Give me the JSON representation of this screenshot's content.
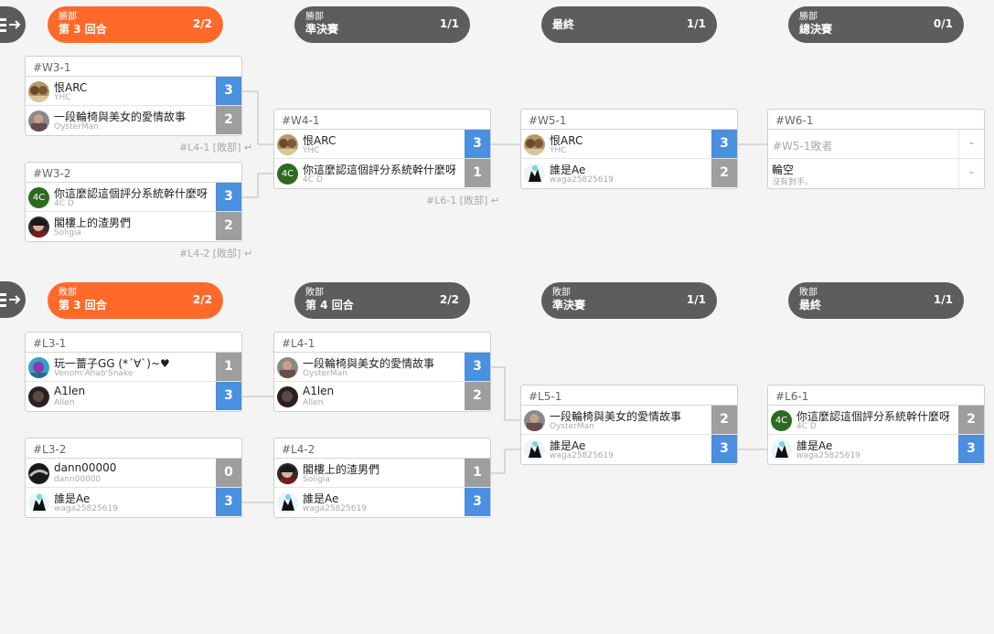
{
  "headers": [
    {
      "id": "w-r3",
      "sub": "勝部",
      "main": "第 3 回合",
      "count": "2/2",
      "style": "orange"
    },
    {
      "id": "w-semi",
      "sub": "勝部",
      "main": "準決賽",
      "count": "1/1",
      "style": "dark"
    },
    {
      "id": "final",
      "sub": "",
      "main": "最終",
      "count": "1/1",
      "style": "dark"
    },
    {
      "id": "w-grand",
      "sub": "勝部",
      "main": "總決賽",
      "count": "0/1",
      "style": "dark"
    },
    {
      "id": "l-r3",
      "sub": "敗部",
      "main": "第 3 回合",
      "count": "2/2",
      "style": "orange"
    },
    {
      "id": "l-r4",
      "sub": "敗部",
      "main": "第 4 回合",
      "count": "2/2",
      "style": "dark"
    },
    {
      "id": "l-semi",
      "sub": "敗部",
      "main": "準決賽",
      "count": "1/1",
      "style": "dark"
    },
    {
      "id": "l-final",
      "sub": "敗部",
      "main": "最終",
      "count": "1/1",
      "style": "dark"
    }
  ],
  "matches": {
    "W3-1": {
      "label": "#W3-1",
      "p1": {
        "name": "恨ARC",
        "sub": "YHC",
        "score": "3",
        "win": true
      },
      "p2": {
        "name": "一段輪椅與美女的愛情故事",
        "sub": "OysterMan",
        "score": "2",
        "win": false
      }
    },
    "W3-2": {
      "label": "#W3-2",
      "p1": {
        "name": "你這麼認這個評分系統幹什麼呀",
        "sub": "4C D",
        "score": "3",
        "win": true
      },
      "p2": {
        "name": "閣樓上的渣男們",
        "sub": "Soligia",
        "score": "2",
        "win": false
      }
    },
    "W4-1": {
      "label": "#W4-1",
      "p1": {
        "name": "恨ARC",
        "sub": "YHC",
        "score": "3",
        "win": true
      },
      "p2": {
        "name": "你這麼認這個評分系統幹什麼呀",
        "sub": "4C D",
        "score": "1",
        "win": false
      }
    },
    "W5-1": {
      "label": "#W5-1",
      "p1": {
        "name": "恨ARC",
        "sub": "YHC",
        "score": "3",
        "win": true
      },
      "p2": {
        "name": "誰是Ae",
        "sub": "waga25825619",
        "score": "2",
        "win": false
      }
    },
    "W6-1": {
      "label": "#W6-1",
      "p1": {
        "name": "#W5-1敗者",
        "sub": "",
        "score": "-",
        "win": null
      },
      "p2": {
        "name": "輪空",
        "sub": "沒有對手。",
        "score": "-",
        "win": null
      }
    },
    "L3-1": {
      "label": "#L3-1",
      "p1": {
        "name": "玩一薔子GG (*´∀`)~♥",
        "sub": "Venom'Ahab'Snake",
        "score": "1",
        "win": false
      },
      "p2": {
        "name": "A1len",
        "sub": "Allen",
        "score": "3",
        "win": true
      }
    },
    "L3-2": {
      "label": "#L3-2",
      "p1": {
        "name": "dann00000",
        "sub": "dann00000",
        "score": "0",
        "win": false
      },
      "p2": {
        "name": "誰是Ae",
        "sub": "waga25825619",
        "score": "3",
        "win": true
      }
    },
    "L4-1": {
      "label": "#L4-1",
      "p1": {
        "name": "一段輪椅與美女的愛情故事",
        "sub": "OysterMan",
        "score": "3",
        "win": true
      },
      "p2": {
        "name": "A1len",
        "sub": "Allen",
        "score": "2",
        "win": false
      }
    },
    "L4-2": {
      "label": "#L4-2",
      "p1": {
        "name": "閣樓上的渣男們",
        "sub": "Soligia",
        "score": "1",
        "win": false
      },
      "p2": {
        "name": "誰是Ae",
        "sub": "waga25825619",
        "score": "3",
        "win": true
      }
    },
    "L5-1": {
      "label": "#L5-1",
      "p1": {
        "name": "一段輪椅與美女的愛情故事",
        "sub": "OysterMan",
        "score": "2",
        "win": false
      },
      "p2": {
        "name": "誰是Ae",
        "sub": "waga25825619",
        "score": "3",
        "win": true
      }
    },
    "L6-1": {
      "label": "#L6-1",
      "p1": {
        "name": "你這麼認這個評分系統幹什麼呀",
        "sub": "4C D",
        "score": "2",
        "win": false
      },
      "p2": {
        "name": "誰是Ae",
        "sub": "waga25825619",
        "score": "3",
        "win": true
      }
    }
  },
  "notes": {
    "w31": "#L4-1 [敗部] ↵",
    "w32": "#L4-2 [敗部] ↵",
    "w41": "#L6-1 [敗部] ↵"
  },
  "avatar_text": "4C"
}
